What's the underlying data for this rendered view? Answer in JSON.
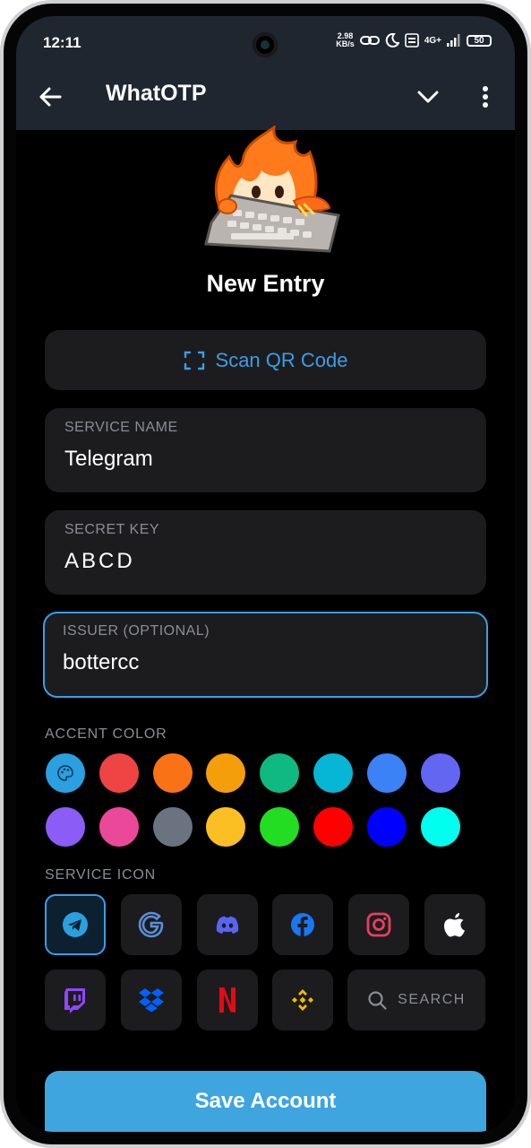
{
  "status_bar": {
    "time": "12:11",
    "net_speed_value": "2.98",
    "net_speed_unit": "KB/s",
    "network": "4G+",
    "battery": "50"
  },
  "app_bar": {
    "title": "WhatOTP",
    "icons": [
      "back-arrow-icon",
      "chevron-down-icon",
      "more-vert-icon"
    ]
  },
  "header": {
    "title": "New Entry"
  },
  "scan_button": {
    "label": "Scan QR Code",
    "icon": "qr-scan-icon"
  },
  "fields": {
    "service_name": {
      "label": "SERVICE NAME",
      "value": "Telegram"
    },
    "secret_key": {
      "label": "SECRET KEY",
      "value": "ABCD"
    },
    "issuer": {
      "label": "ISSUER (OPTIONAL)",
      "value": "bottercc"
    }
  },
  "accent_color": {
    "label": "ACCENT COLOR",
    "selected_index": 0,
    "colors": [
      "#2aa0e0",
      "#ef4444",
      "#f97316",
      "#f59e0b",
      "#10b981",
      "#06b6d4",
      "#3b82f6",
      "#6366f1",
      "#8b5cf6",
      "#ec4899",
      "#6b7280",
      "#fbbf24",
      "#22dd22",
      "#ff0000",
      "#0000ff",
      "#00ffee"
    ]
  },
  "service_icon": {
    "label": "SERVICE ICON",
    "selected": "telegram",
    "icons": [
      "telegram-icon",
      "google-icon",
      "discord-icon",
      "facebook-icon",
      "instagram-icon",
      "apple-icon",
      "twitch-icon",
      "dropbox-icon",
      "netflix-icon",
      "binance-icon"
    ],
    "search_label": "SEARCH"
  },
  "save_button": {
    "label": "Save Account"
  }
}
